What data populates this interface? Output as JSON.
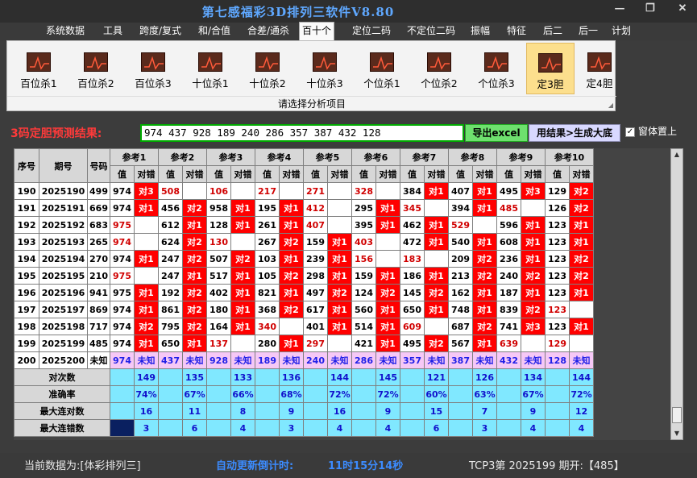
{
  "window": {
    "title": "第七感福彩3D排列三软件V8.80"
  },
  "menu": [
    "系统数据",
    "工具",
    "跨度/复式",
    "和/合值",
    "合差/通杀",
    "百十个",
    "定位二码",
    "不定位二码",
    "振幅",
    "特征",
    "后二",
    "后一",
    "计划"
  ],
  "menu_active": 5,
  "ribbon": {
    "buttons": [
      "百位杀1",
      "百位杀2",
      "百位杀3",
      "十位杀1",
      "十位杀2",
      "十位杀3",
      "个位杀1",
      "个位杀2",
      "个位杀3",
      "定3胆",
      "定4胆"
    ],
    "active_index": 9,
    "caption": "请选择分析项目"
  },
  "predict": {
    "label": "3码定胆预测结果:",
    "value": "974 437 928 189 240 286 357 387 432 128",
    "excel_button": "导出excel",
    "result_button": "用结果>生成大底",
    "topmost_checkbox": "窗体置上",
    "topmost_checked": "✓"
  },
  "table": {
    "headers": {
      "seq": "序号",
      "period": "期号",
      "number": "号码",
      "value": "值",
      "hit": "对错"
    },
    "refs": [
      "参考1",
      "参考2",
      "参考3",
      "参考4",
      "参考5",
      "参考6",
      "参考7",
      "参考8",
      "参考9",
      "参考10"
    ],
    "rows": [
      {
        "seq": "190",
        "period": "2025190",
        "num": "499",
        "cells": [
          [
            "974",
            "对3"
          ],
          [
            "508",
            ""
          ],
          [
            "106",
            ""
          ],
          [
            "217",
            ""
          ],
          [
            "271",
            ""
          ],
          [
            "328",
            ""
          ],
          [
            "384",
            "对1"
          ],
          [
            "407",
            "对1"
          ],
          [
            "495",
            "对3"
          ],
          [
            "129",
            "对2"
          ]
        ]
      },
      {
        "seq": "191",
        "period": "2025191",
        "num": "669",
        "cells": [
          [
            "974",
            "对1"
          ],
          [
            "456",
            "对2"
          ],
          [
            "958",
            "对1"
          ],
          [
            "195",
            "对1"
          ],
          [
            "412",
            ""
          ],
          [
            "295",
            "对1"
          ],
          [
            "345",
            ""
          ],
          [
            "394",
            "对1"
          ],
          [
            "485",
            ""
          ],
          [
            "126",
            "对2"
          ]
        ]
      },
      {
        "seq": "192",
        "period": "2025192",
        "num": "683",
        "cells": [
          [
            "975",
            ""
          ],
          [
            "612",
            "对1"
          ],
          [
            "128",
            "对1"
          ],
          [
            "261",
            "对1"
          ],
          [
            "407",
            ""
          ],
          [
            "395",
            "对1"
          ],
          [
            "462",
            "对1"
          ],
          [
            "529",
            ""
          ],
          [
            "596",
            "对1"
          ],
          [
            "123",
            "对1"
          ]
        ]
      },
      {
        "seq": "193",
        "period": "2025193",
        "num": "265",
        "cells": [
          [
            "974",
            ""
          ],
          [
            "624",
            "对2"
          ],
          [
            "130",
            ""
          ],
          [
            "267",
            "对2"
          ],
          [
            "159",
            "对1"
          ],
          [
            "403",
            ""
          ],
          [
            "472",
            "对1"
          ],
          [
            "540",
            "对1"
          ],
          [
            "608",
            "对1"
          ],
          [
            "123",
            "对1"
          ]
        ]
      },
      {
        "seq": "194",
        "period": "2025194",
        "num": "270",
        "cells": [
          [
            "974",
            "对1"
          ],
          [
            "247",
            "对2"
          ],
          [
            "507",
            "对2"
          ],
          [
            "103",
            "对1"
          ],
          [
            "239",
            "对1"
          ],
          [
            "156",
            ""
          ],
          [
            "183",
            ""
          ],
          [
            "209",
            "对2"
          ],
          [
            "236",
            "对1"
          ],
          [
            "123",
            "对2"
          ]
        ]
      },
      {
        "seq": "195",
        "period": "2025195",
        "num": "210",
        "cells": [
          [
            "975",
            ""
          ],
          [
            "247",
            "对1"
          ],
          [
            "517",
            "对1"
          ],
          [
            "105",
            "对2"
          ],
          [
            "298",
            "对1"
          ],
          [
            "159",
            "对1"
          ],
          [
            "186",
            "对1"
          ],
          [
            "213",
            "对2"
          ],
          [
            "240",
            "对2"
          ],
          [
            "123",
            "对2"
          ]
        ]
      },
      {
        "seq": "196",
        "period": "2025196",
        "num": "941",
        "cells": [
          [
            "975",
            "对1"
          ],
          [
            "192",
            "对2"
          ],
          [
            "402",
            "对1"
          ],
          [
            "821",
            "对1"
          ],
          [
            "497",
            "对2"
          ],
          [
            "124",
            "对2"
          ],
          [
            "145",
            "对2"
          ],
          [
            "162",
            "对1"
          ],
          [
            "187",
            "对1"
          ],
          [
            "123",
            "对1"
          ]
        ]
      },
      {
        "seq": "197",
        "period": "2025197",
        "num": "869",
        "cells": [
          [
            "974",
            "对1"
          ],
          [
            "861",
            "对2"
          ],
          [
            "180",
            "对1"
          ],
          [
            "368",
            "对2"
          ],
          [
            "617",
            "对1"
          ],
          [
            "560",
            "对1"
          ],
          [
            "650",
            "对1"
          ],
          [
            "748",
            "对1"
          ],
          [
            "839",
            "对2"
          ],
          [
            "123",
            ""
          ]
        ]
      },
      {
        "seq": "198",
        "period": "2025198",
        "num": "717",
        "cells": [
          [
            "974",
            "对2"
          ],
          [
            "795",
            "对2"
          ],
          [
            "164",
            "对1"
          ],
          [
            "340",
            ""
          ],
          [
            "401",
            "对1"
          ],
          [
            "514",
            "对1"
          ],
          [
            "609",
            ""
          ],
          [
            "687",
            "对2"
          ],
          [
            "741",
            "对3"
          ],
          [
            "123",
            "对1"
          ]
        ]
      },
      {
        "seq": "199",
        "period": "2025199",
        "num": "485",
        "cells": [
          [
            "974",
            "对1"
          ],
          [
            "650",
            "对1"
          ],
          [
            "137",
            ""
          ],
          [
            "280",
            "对1"
          ],
          [
            "297",
            ""
          ],
          [
            "421",
            "对1"
          ],
          [
            "495",
            "对2"
          ],
          [
            "567",
            "对1"
          ],
          [
            "639",
            ""
          ],
          [
            "129",
            ""
          ]
        ]
      },
      {
        "seq": "200",
        "period": "2025200",
        "num": "未知",
        "cells": [
          [
            "974",
            "未知"
          ],
          [
            "437",
            "未知"
          ],
          [
            "928",
            "未知"
          ],
          [
            "189",
            "未知"
          ],
          [
            "240",
            "未知"
          ],
          [
            "286",
            "未知"
          ],
          [
            "357",
            "未知"
          ],
          [
            "387",
            "未知"
          ],
          [
            "432",
            "未知"
          ],
          [
            "128",
            "未知"
          ]
        ]
      }
    ],
    "stats": [
      {
        "label": "对次数",
        "values": [
          "149",
          "135",
          "133",
          "136",
          "144",
          "145",
          "121",
          "126",
          "134",
          "144"
        ]
      },
      {
        "label": "准确率",
        "values": [
          "74%",
          "67%",
          "66%",
          "68%",
          "72%",
          "72%",
          "60%",
          "63%",
          "67%",
          "72%"
        ]
      },
      {
        "label": "最大连对数",
        "values": [
          "16",
          "11",
          "8",
          "9",
          "16",
          "9",
          "15",
          "7",
          "9",
          "12"
        ]
      },
      {
        "label": "最大连错数",
        "values": [
          "3",
          "6",
          "4",
          "3",
          "4",
          "4",
          "6",
          "3",
          "4",
          "4"
        ]
      }
    ]
  },
  "status": {
    "current_data": "当前数据为:[体彩排列三]",
    "countdown_label": "自动更新倒计时:",
    "countdown_value": "11时15分14秒",
    "draw_info": "TCP3第 2025199 期开:【485】"
  }
}
